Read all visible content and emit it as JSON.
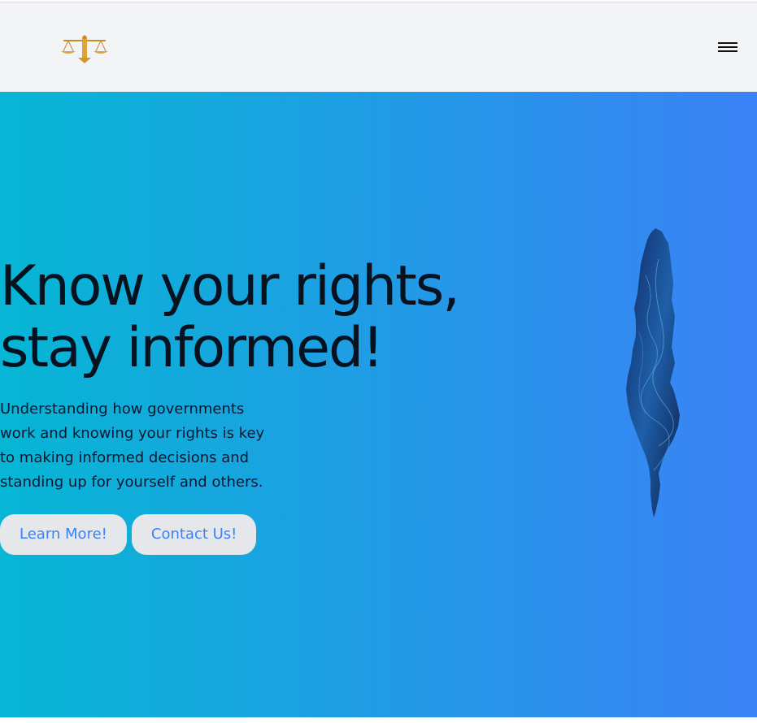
{
  "header": {
    "logo_icon": "scales-of-justice-icon",
    "menu_icon": "hamburger-menu-icon"
  },
  "hero": {
    "title_line1": "Know your rights,",
    "title_line2": "stay informed!",
    "description": "Understanding how governments work and knowing your rights is key to making informed decisions and standing up for yourself and others.",
    "learn_more_label": "Learn More!",
    "contact_label": "Contact Us!",
    "map_icon": "country-map-silhouette"
  },
  "colors": {
    "header_bg": "#f3f4f6",
    "hero_gradient_start": "#06b6d4",
    "hero_gradient_end": "#3b82f6",
    "button_bg": "#e5e7eb",
    "button_text": "#3b82f6",
    "title_text": "#06121f"
  }
}
